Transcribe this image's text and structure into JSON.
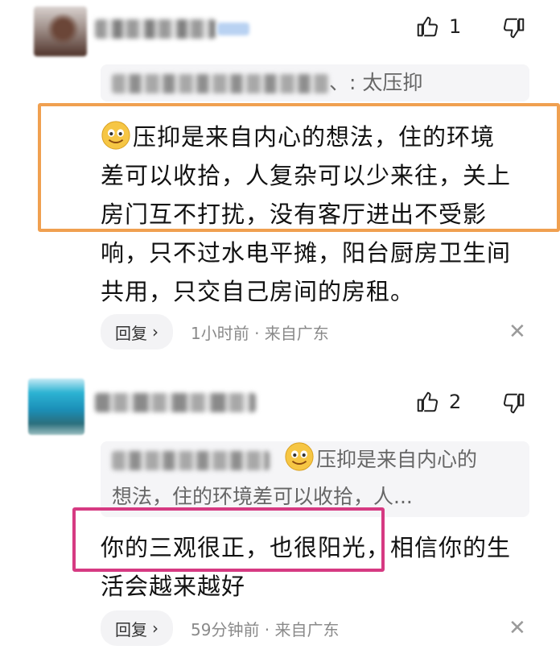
{
  "comments": [
    {
      "likes": "1",
      "quote_text": "太压抑",
      "body_lines": [
        "压抑是来自内心的想法，住的环境",
        "差可以收拾，人复杂可以少来往，关上",
        "房门互不打扰，没有客厅进出不受影",
        "响，只不过水电平摊，阳台厨房卫生间",
        "共用，只交自己房间的房租。"
      ],
      "reply_label": "回复",
      "reply_chevron": "›",
      "meta": "1小时前 · 来自广东",
      "close": "✕"
    },
    {
      "likes": "2",
      "quote_line1": "压抑是来自内心的",
      "quote_line2": "想法，住的环境差可以收拾，人...",
      "body_lines": [
        "你的三观很正，也很阳光，相信你的生",
        "活会越来越好"
      ],
      "reply_label": "回复",
      "reply_chevron": "›",
      "meta": "59分钟前 · 来自广东",
      "close": "✕"
    }
  ],
  "quote_separator": "、:",
  "colors": {
    "orange_highlight": "#f0a050",
    "pink_highlight": "#d63a82"
  },
  "icons": [
    "thumbs-up-icon",
    "thumbs-down-icon",
    "smiley-emoji-icon",
    "close-icon"
  ]
}
